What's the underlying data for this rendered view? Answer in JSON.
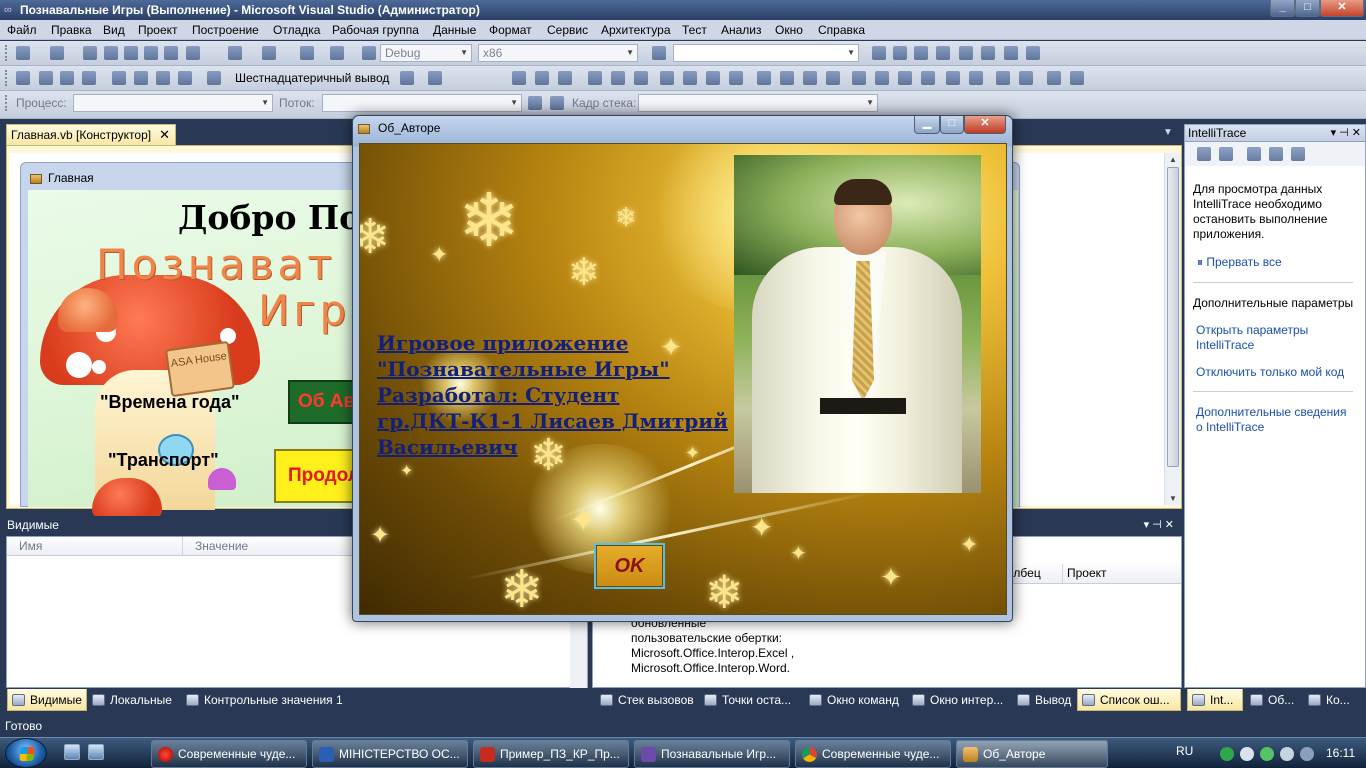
{
  "window": {
    "title": "Познавальные Игры (Выполнение) - Microsoft Visual Studio (Администратор)",
    "controls": [
      "_",
      "□",
      "✕"
    ]
  },
  "menu": [
    "Файл",
    "Правка",
    "Вид",
    "Проект",
    "Построение",
    "Отладка",
    "Рабочая группа",
    "Данные",
    "Формат",
    "Сервис",
    "Архитектура",
    "Тест",
    "Анализ",
    "Окно",
    "Справка"
  ],
  "toolbar1": {
    "config": "Debug",
    "platform": "x86",
    "find": ""
  },
  "toolbar2": {
    "hex_display": "Шестнадцатеричный вывод"
  },
  "toolbar3": {
    "process_label": "Процесс:",
    "thread_label": "Поток:",
    "stack_frame_label": "Кадр стека:"
  },
  "doc_tab": {
    "label": "Главная.vb [Конструктор]",
    "close": "✕"
  },
  "design_form": {
    "title": "Главная",
    "welcome": "Добро Пож",
    "game_title_1": "Познават",
    "game_title_2": "Игр",
    "sign": "ASA House",
    "seasons": "\"Времена года\"",
    "transport": "\"Транспорт\"",
    "about_button": "Об Ав",
    "continue_button": "Продол"
  },
  "intellitrace": {
    "header": "IntelliTrace",
    "header_controls": "▾ ⊣ ✕",
    "message": "Для просмотра данных IntelliTrace необходимо остановить выполнение приложения.",
    "break_all": "Прервать все",
    "advanced_title": "Дополнительные параметры",
    "links": [
      "Открыть параметры IntelliTrace",
      "Отключить только мой код",
      "Дополнительные сведения о IntelliTrace"
    ]
  },
  "watch_panel": {
    "header": "Видимые",
    "header_controls": "▾ ⊣ ✕",
    "columns": [
      "Имя",
      "Значение"
    ]
  },
  "error_panel": {
    "header_controls": "▾ ⊣ ✕",
    "columns": [
      "олбец",
      "Проект"
    ],
    "description": [
      "обновленные",
      "пользовательские обертки:",
      "Microsoft.Office.Interop.Excel ,",
      "Microsoft.Office.Interop.Word."
    ]
  },
  "bottom_tabs_left": [
    "Видимые",
    "Локальные",
    "Контрольные значения 1"
  ],
  "bottom_tabs_right": [
    "Стек вызовов",
    "Точки оста...",
    "Окно команд",
    "Окно интер...",
    "Вывод",
    "Список ош..."
  ],
  "bottom_tabs_far": [
    "Int...",
    "Об...",
    "Ко..."
  ],
  "status": "Готово",
  "about_dialog": {
    "title": "Об_Авторе",
    "text_lines": [
      "Игровое приложение",
      "\"Познавательные Игры\"",
      "Разработал: Студент",
      "гр.ДКТ-К1-1 Лисаев Дмитрий",
      "Васильевич"
    ],
    "ok": "OK"
  },
  "taskbar": {
    "tasks": [
      "Современные чуде...",
      "МІНІСТЕРСТВО ОС...",
      "Пример_ПЗ_КР_Пр...",
      "Познавальные Игр...",
      "Современные чуде...",
      "Об_Авторе"
    ],
    "lang": "RU",
    "clock": "16:11"
  }
}
